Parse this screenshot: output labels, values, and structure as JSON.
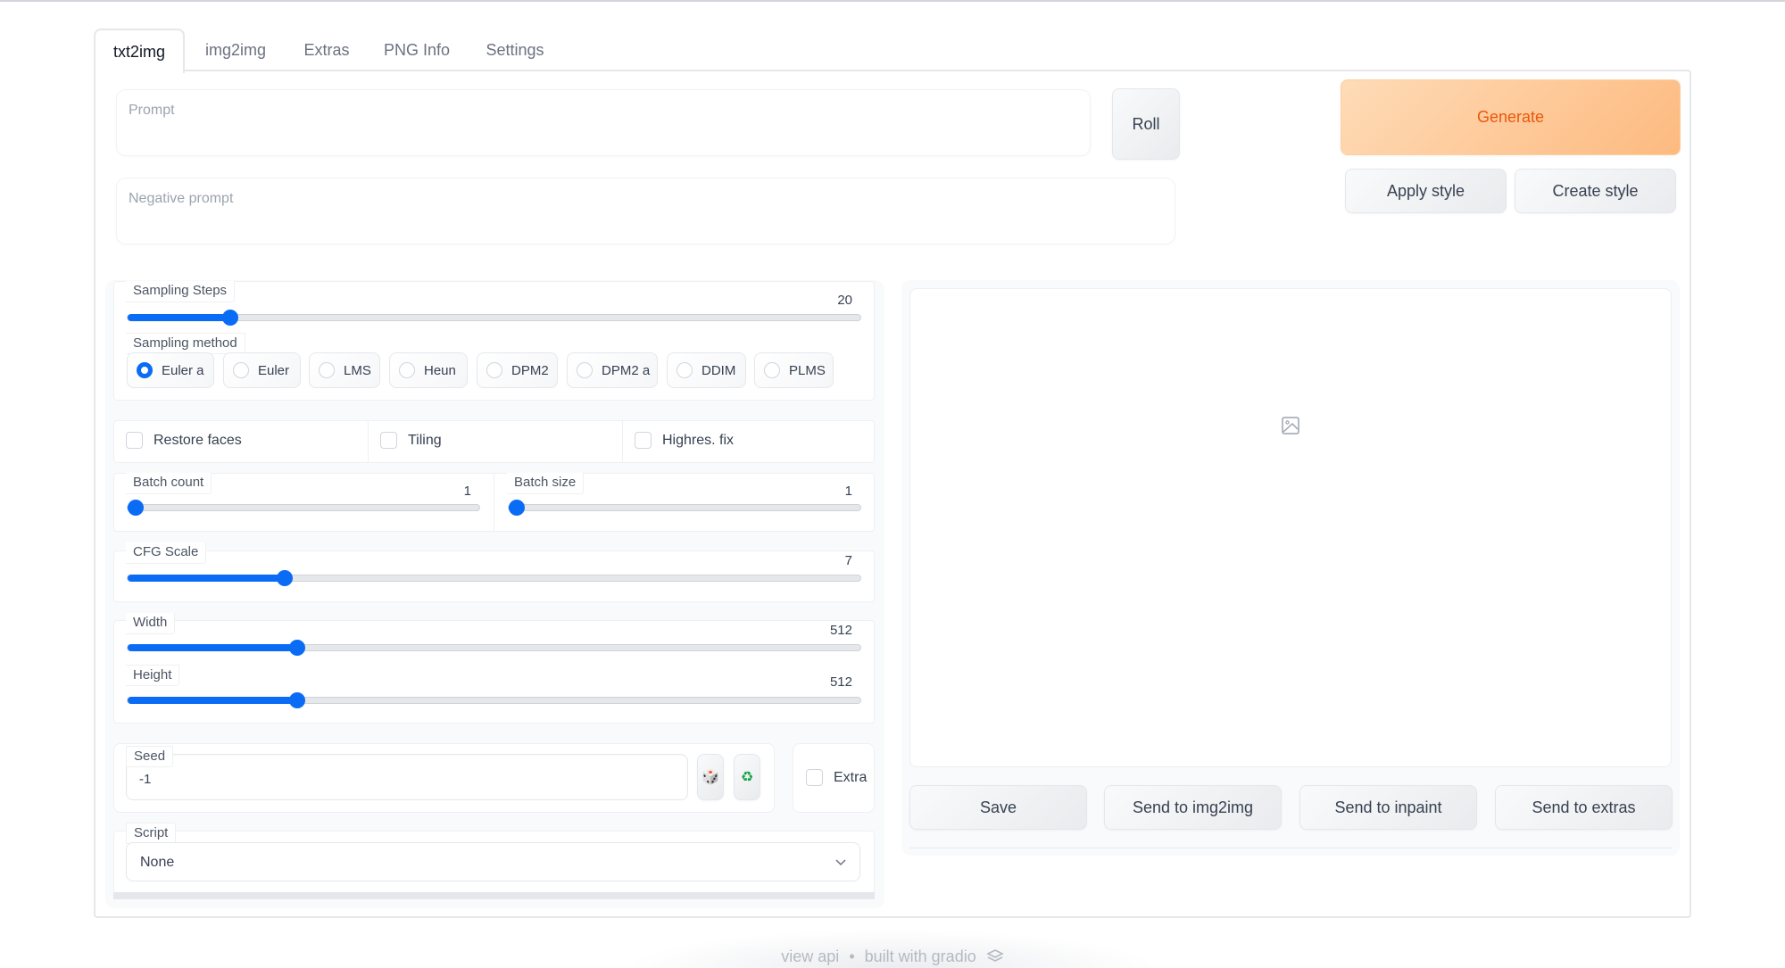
{
  "tabs": [
    {
      "label": "txt2img",
      "active": true
    },
    {
      "label": "img2img",
      "active": false
    },
    {
      "label": "Extras",
      "active": false
    },
    {
      "label": "PNG Info",
      "active": false
    },
    {
      "label": "Settings",
      "active": false
    }
  ],
  "prompt": {
    "placeholder": "Prompt",
    "value": ""
  },
  "negative_prompt": {
    "placeholder": "Negative prompt",
    "value": ""
  },
  "buttons": {
    "roll": "Roll",
    "generate": "Generate",
    "apply_style": "Apply style",
    "create_style": "Create style"
  },
  "colors": {
    "accent": "#0a6cf5",
    "generate_text": "#ea580c",
    "generate_bg": "#fdba80"
  },
  "sampling_steps": {
    "label": "Sampling Steps",
    "value": "20",
    "fraction": 0.14
  },
  "sampling_method": {
    "label": "Sampling method",
    "selected": "Euler a",
    "options": [
      "Euler a",
      "Euler",
      "LMS",
      "Heun",
      "DPM2",
      "DPM2 a",
      "DDIM",
      "PLMS"
    ]
  },
  "checkboxes": {
    "restore_faces": {
      "label": "Restore faces",
      "checked": false
    },
    "tiling": {
      "label": "Tiling",
      "checked": false
    },
    "highres_fix": {
      "label": "Highres. fix",
      "checked": false
    }
  },
  "batch_count": {
    "label": "Batch count",
    "value": "1",
    "fraction": 0.0
  },
  "batch_size": {
    "label": "Batch size",
    "value": "1",
    "fraction": 0.0
  },
  "cfg_scale": {
    "label": "CFG Scale",
    "value": "7",
    "fraction": 0.214
  },
  "width": {
    "label": "Width",
    "value": "512",
    "fraction": 0.232
  },
  "height": {
    "label": "Height",
    "value": "512",
    "fraction": 0.232
  },
  "seed": {
    "label": "Seed",
    "value": "-1",
    "random_icon": "dice-icon",
    "reuse_icon": "recycle-icon"
  },
  "extra": {
    "label": "Extra",
    "checked": false
  },
  "script": {
    "label": "Script",
    "selected": "None"
  },
  "output": {
    "placeholder_icon": "image-icon",
    "actions": [
      "Save",
      "Send to img2img",
      "Send to inpaint",
      "Send to extras"
    ]
  },
  "footer": {
    "view_api": "view api",
    "separator": "•",
    "built_with": "built with gradio"
  }
}
